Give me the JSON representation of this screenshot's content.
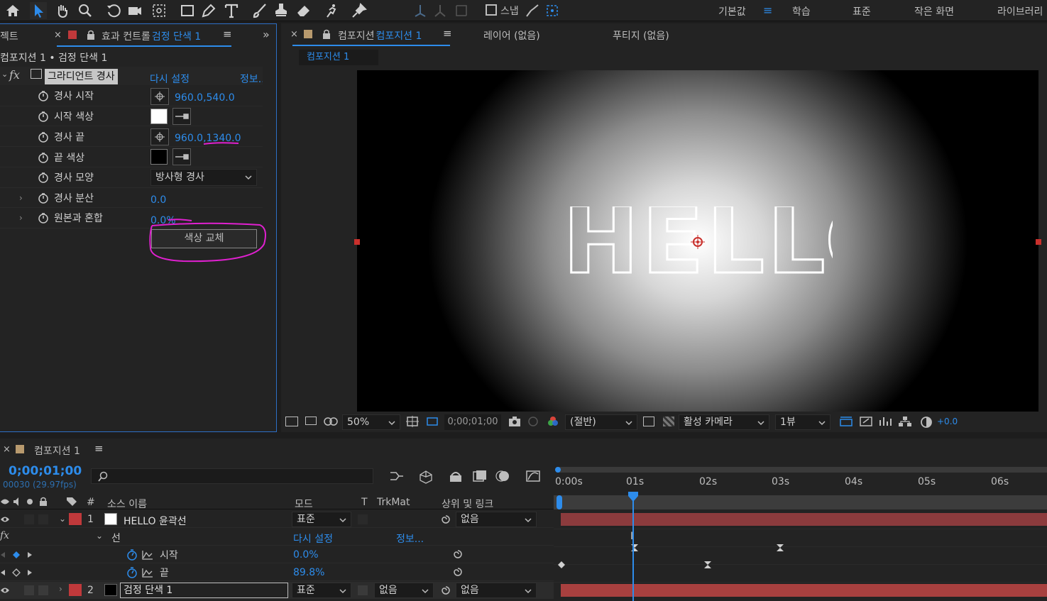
{
  "toolbar": {
    "snap_label": "스냅",
    "workspaces": [
      "기본값",
      "학습",
      "표준",
      "작은 화면",
      "라이브러리"
    ],
    "active_workspace_index": 0
  },
  "effects_panel": {
    "left_tab_fragment": "젝트",
    "tab_label": "효과 컨트롤",
    "tab_target": "검정 단색 1",
    "breadcrumb": "컴포지션 1 • 검정 단색 1",
    "effect_name": "그라디언트 경사",
    "reset_label": "다시 설정",
    "about_label": "정보...",
    "properties": [
      {
        "label": "경사 시작",
        "value": "960.0,540.0"
      },
      {
        "label": "시작 색상",
        "color": "#ffffff"
      },
      {
        "label": "경사 끝",
        "value": "960.0,1340.0"
      },
      {
        "label": "끝 색상",
        "color": "#000000"
      },
      {
        "label": "경사 모양",
        "value": "방사형 경사"
      },
      {
        "label": "경사 분산",
        "value": "0.0"
      },
      {
        "label": "원본과 혼합",
        "value": "0.0%"
      }
    ],
    "swap_colors_button": "색상 교체",
    "annotation_color": "#e020d0"
  },
  "comp_panel": {
    "tab_label": "컴포지션",
    "tab_target": "컴포지션 1",
    "layer_tab": "레이어 (없음)",
    "footage_tab": "푸티지 (없음)",
    "comp_chip": "컴포지션 1",
    "viewer_text": "HELLO",
    "bottom_bar": {
      "zoom": "50%",
      "timecode": "0;00;01;00",
      "resolution": "(절반)",
      "camera": "활성 카메라",
      "views": "1뷰",
      "exposure": "+0.0"
    }
  },
  "timeline": {
    "tab_label": "컴포지션 1",
    "current_time": "0;00;01;00",
    "frame_info": "00030 (29.97fps)",
    "search_placeholder": "",
    "ruler": [
      "0:00s",
      "01s",
      "02s",
      "03s",
      "04s",
      "05s",
      "06s"
    ],
    "columns": {
      "hash": "#",
      "source_name": "소스 이름",
      "mode": "모드",
      "t": "T",
      "trkmat": "TrkMat",
      "parent": "상위 및 링크"
    },
    "layers": [
      {
        "index": "1",
        "name": "HELLO 윤곽선",
        "mode": "표준",
        "parent": "없음",
        "label_color": "#c0393b",
        "swatch": "#ffffff"
      },
      {
        "index": "2",
        "name": "검정 단색 1",
        "mode": "표준",
        "trkmat": "없음",
        "parent": "없음",
        "label_color": "#c0393b",
        "swatch": "#000000"
      }
    ],
    "fx_group": {
      "name": "선",
      "reset_label": "다시 설정",
      "about_label": "정보..."
    },
    "sub_props": [
      {
        "label": "시작",
        "value": "0.0%"
      },
      {
        "label": "끝",
        "value": "89.8%"
      }
    ],
    "accent": "#2d8ceb"
  }
}
